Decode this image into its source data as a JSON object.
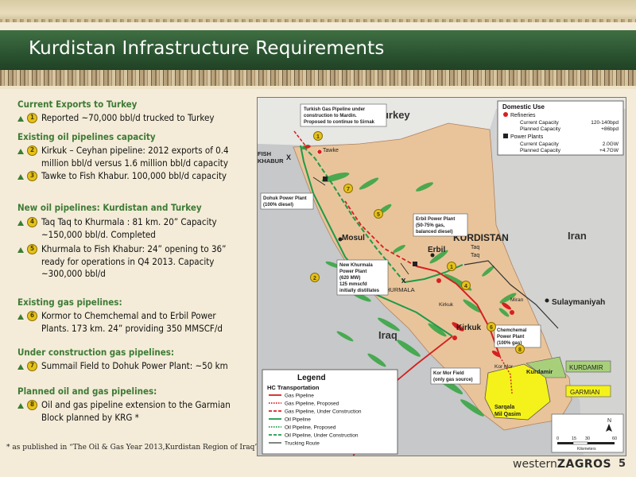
{
  "slide": {
    "title": "Kurdistan Infrastructure Requirements",
    "page_number": "5",
    "logo_text_regular": "western",
    "logo_text_bold": "ZAGROS",
    "footnote": "* as published in “The Oil & Gas Year 2013,Kurdistan Region of Iraq”"
  },
  "sections": [
    {
      "heading": "Current Exports to Turkey",
      "items": [
        {
          "num": "1",
          "lines": [
            "Reported ~70,000 bbl/d trucked to Turkey"
          ]
        }
      ]
    },
    {
      "heading": "Existing oil pipelines capacity",
      "items": [
        {
          "num": "2",
          "lines": [
            "Kirkuk – Ceyhan pipeline: 2012 exports of 0.4",
            "million bbl/d versus 1.6 million bbl/d capacity"
          ]
        },
        {
          "num": "3",
          "lines": [
            "Tawke to Fish Khabur. 100,000 bbl/d capacity"
          ]
        }
      ]
    },
    {
      "heading": "New oil pipelines: Kurdistan and Turkey",
      "items": [
        {
          "num": "4",
          "lines": [
            "Taq  Taq to Khurmala : 81 km. 20”  Capacity",
            "~150,000 bbl/d. Completed"
          ]
        },
        {
          "num": "5",
          "lines": [
            "Khurmala to Fish Khabur:  24” opening to 36”",
            "ready for operations in Q4 2013. Capacity",
            "~300,000 bbl/d"
          ]
        }
      ]
    },
    {
      "heading": "Existing gas pipelines:",
      "items": [
        {
          "num": "6",
          "lines": [
            "Kormor to Chemchemal and to Erbil Power",
            "Plants. 173 km. 24” providing 350 MMSCF/d"
          ]
        }
      ]
    },
    {
      "heading": "Under construction gas pipelines:",
      "items": [
        {
          "num": "7",
          "lines": [
            "Summail Field to Dohuk Power Plant: ~50 km"
          ]
        }
      ]
    },
    {
      "heading": "Planned oil and gas pipelines:",
      "items": [
        {
          "num": "8",
          "lines": [
            "Oil and gas pipeline extension to the Garmian",
            "Block planned by KRG *"
          ]
        }
      ]
    }
  ],
  "map": {
    "countries": {
      "turkey": "Turkey",
      "iran": "Iran",
      "iraq": "Iraq",
      "kurdistan": "KURDISTAN"
    },
    "places": {
      "fish_khabur": [
        "FISH",
        "KHABUR"
      ],
      "tawke": "Tawke",
      "mosul": "Mosul",
      "erbil": "Erbil",
      "khurmala": "KHURMALA",
      "kirkuk": "Kirkuk",
      "kirkuk_small": "Kirkuk",
      "taq_taq": [
        "Taq",
        "Taq"
      ],
      "miran": "Miran",
      "sulaymaniyah": "Sulaymaniyah",
      "kor_mor": "Kor Mor",
      "kurdamir_city": "Kurdamir",
      "sarqala": [
        "Sarqala",
        "Mil Qasim"
      ],
      "kurdamir_block": "KURDAMIR",
      "garmian_block": "GARMIAN"
    },
    "callouts": {
      "turkish_gas": [
        "Turkish Gas Pipeline under",
        "construction to Mardin.",
        "Proposed to continue to Sirnak"
      ],
      "dohuk": [
        "Dohuk Power Plant",
        "(100% diesel)"
      ],
      "erbil_pp": [
        "Erbil Power Plant",
        "(50-75% gas,",
        "balanced diesel)"
      ],
      "khurmala_pp": [
        "New Khurmala",
        "Power Plant",
        "(620 MW)",
        "125 mmscfd",
        "initially distillates"
      ],
      "chemchemal": [
        "Chemchemal",
        "Power Plant",
        "(100% gas)"
      ],
      "kor_mor_field": [
        "Kor Mor Field",
        "(only gas source)"
      ]
    },
    "domestic_use": {
      "title": "Domestic Use",
      "refineries_label": "Refineries",
      "power_label": "Power Plants",
      "rows_refineries": [
        {
          "label": "Current Capacity",
          "value": "120-140bpd"
        },
        {
          "label": "Planned Capacity",
          "value": "+86bpd"
        }
      ],
      "rows_power": [
        {
          "label": "Current Capacity",
          "value": "2.0GW"
        },
        {
          "label": "Planned Capacity",
          "value": "+4.7GW"
        }
      ]
    },
    "legend": {
      "title": "Legend",
      "subtitle": "HC Transportation",
      "entries": [
        {
          "label": "Gas Pipeline",
          "color": "#d62020",
          "style": "solid"
        },
        {
          "label": "Gas Pipeline, Proposed",
          "color": "#d62020",
          "style": "dotted"
        },
        {
          "label": "Gas Pipeline, Under Construction",
          "color": "#d62020",
          "style": "dashed"
        },
        {
          "label": "Oil Pipeline",
          "color": "#1f9a4a",
          "style": "solid"
        },
        {
          "label": "Oil Pipeline, Proposed",
          "color": "#1f9a4a",
          "style": "dotted"
        },
        {
          "label": "Oil Pipeline, Under Construction",
          "color": "#1f9a4a",
          "style": "dashed"
        },
        {
          "label": "Trucking Route",
          "color": "#333333",
          "style": "solid"
        }
      ]
    },
    "scale": {
      "ticks": [
        "0",
        "15",
        "30",
        "60"
      ],
      "unit": "Kilometers"
    },
    "north": "N",
    "markers": [
      "1",
      "2",
      "3",
      "4",
      "5",
      "6",
      "7",
      "8"
    ]
  },
  "colors": {
    "title_bar": "#2c5531",
    "heading_green": "#3e7a36",
    "kurdistan_fill": "#e9c49a",
    "field_green": "#3aa646",
    "gas_red": "#d62020",
    "oil_green": "#1f9a4a",
    "garmian_yellow": "#f4f21a",
    "kurdamir_green": "#a8d07a"
  }
}
